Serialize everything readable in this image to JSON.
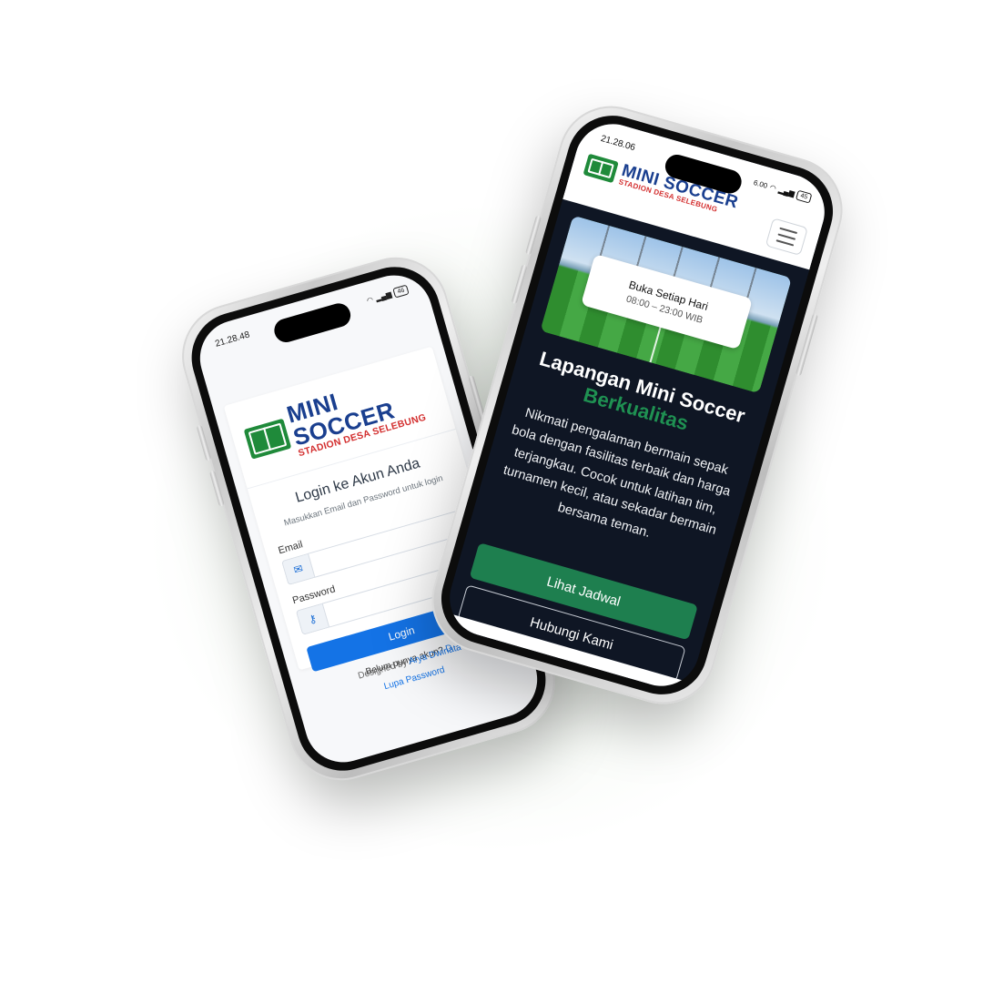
{
  "login_phone": {
    "status": {
      "time": "21.28.48",
      "battery": "46"
    },
    "logo": {
      "title": "MINI SOCCER",
      "subtitle": "STADION DESA SELEBUNG"
    },
    "heading": "Login ke Akun Anda",
    "subheading": "Masukkan Email dan Password untuk login",
    "email_label": "Email",
    "email_value": "",
    "password_label": "Password",
    "password_value": "",
    "login_button": "Login",
    "register_prompt": "Belum punya akun?",
    "register_link": "D",
    "forgot_link": "Lupa Password",
    "designed_by_prefix": "Designed by",
    "designed_by_name": "Arya Dwinata",
    "icons": {
      "email": "envelope-icon",
      "password": "key-icon"
    }
  },
  "landing_phone": {
    "status": {
      "time": "21.28.06",
      "data_rate": "6.00",
      "battery": "45"
    },
    "logo": {
      "title": "MINI SOCCER",
      "subtitle": "STADION DESA SELEBUNG"
    },
    "menu_icon": "hamburger-icon",
    "hours_title": "Buka Setiap Hari",
    "hours_time": "08:00 – 23:00 WIB",
    "hero_title": "Lapangan Mini Soccer",
    "hero_highlight": "Berkualitas",
    "hero_description": "Nikmati pengalaman bermain sepak bola dengan fasilitas terbaik dan harga terjangkau. Cocok untuk latihan tim, turnamen kecil, atau sekadar bermain bersama teman.",
    "primary_button": "Lihat Jadwal",
    "secondary_button": "Hubungi Kami"
  },
  "colors": {
    "brand_blue": "#1a3f8f",
    "brand_red": "#d32f2f",
    "brand_green": "#1f8a3a",
    "login_button": "#1473e6",
    "cta_green": "#1e7f4f",
    "landing_background": "#0f1624"
  }
}
